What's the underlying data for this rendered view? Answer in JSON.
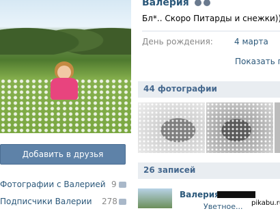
{
  "profile": {
    "name": "Валерия",
    "status": "Бл*.. Скоро Питарды и снежки)))",
    "birthday_label": "День рождения:",
    "birthday_value": "4 марта",
    "show_more": "Показать по"
  },
  "sidebar": {
    "add_friend": "Добавить в друзья",
    "links": [
      {
        "label": "Фотографии с Валерией",
        "count": "9"
      },
      {
        "label": "Подписчики Валерии",
        "count": "278"
      }
    ]
  },
  "photos": {
    "header": "44 фотографии"
  },
  "wall": {
    "header": "26 записей",
    "post_author": "Валерия",
    "post_sub": "Уветное..."
  },
  "watermark": "pikabu.ru"
}
